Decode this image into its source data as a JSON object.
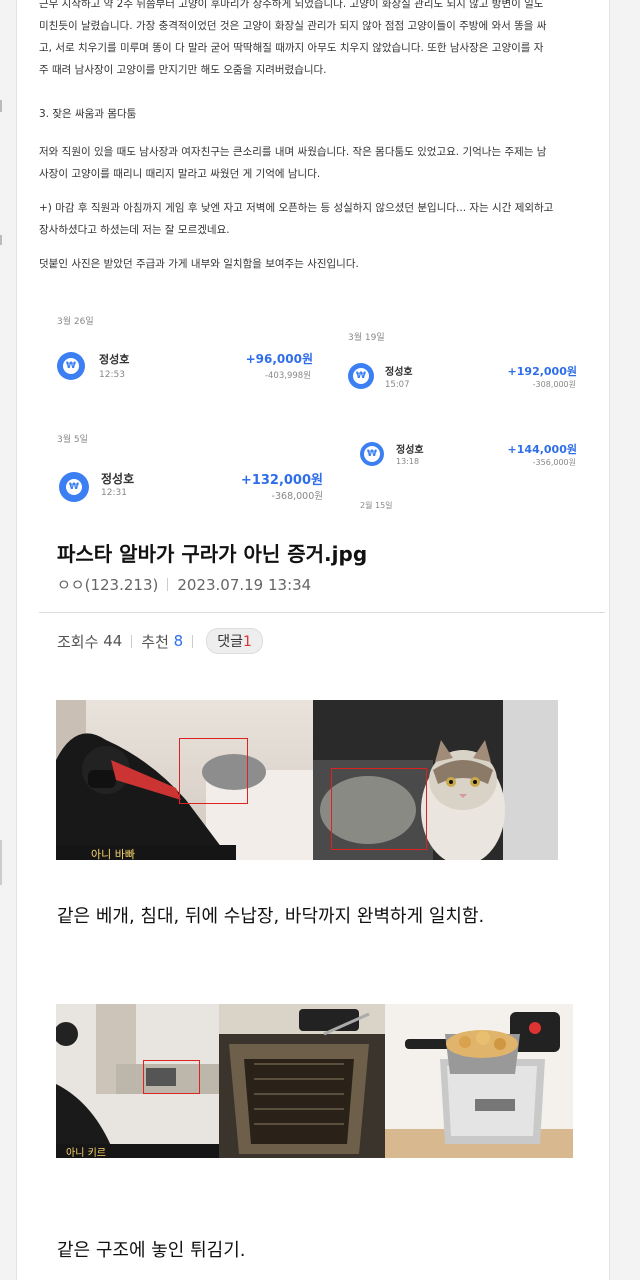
{
  "screenshot": {
    "para1_line1": "근무 시작하고 약 2주 뒤쯤부터 고양이 후마리가 상주하게 되었습니다. 고양이 화장실 관리도 되지 않고 방변이 일도",
    "para1_line2": "미친듯이 날렸습니다. 가장 충격적이었던 것은 고양이 화장실 관리가 되지 않아 점점 고양이들이 주방에 와서 똥을 싸",
    "para1_line3": "고, 서로 치우기를 미루며 똥이 다 말라 굳어 딱딱해질 때까지 아무도 치우지 않았습니다. 또한 남사장은 고양이를 자",
    "para1_line4": "주 때려 남사장이 고양이를 만지기만 해도 오줌을 지려버렸습니다.",
    "heading3": "3. 잦은 싸움과 몸다툼",
    "para2_line1": "저와 직원이 있을 때도 남사장과 여자친구는 큰소리를 내며 싸웠습니다. 작은 몸다툼도 있었고요. 기억나는 주제는 남",
    "para2_line2": "사장이 고양이를 때리니 때리지 말라고 싸웠던 게 기억에 남니다.",
    "para3_line1": "+) 마감 후 직원과 아침까지 게임 후 낮엔 자고 저벽에 오픈하는 등 성실하지 않으셨던 분입니다... 자는 시간 제외하고",
    "para3_line2": "장사하셨다고 하셨는데 저는 잘 모르겠네요.",
    "para4": "덧붙인 사진은 받았던 주급과 가게 내부와 일치함을 보여주는 사진입니다.",
    "transactions": [
      {
        "date": "3월 26일",
        "name": "정성호",
        "time": "12:53",
        "amount": "+96,000원",
        "balance": "-403,998원"
      },
      {
        "date": "3월 19일",
        "name": "정성호",
        "time": "15:07",
        "amount": "+192,000원",
        "balance": "-308,000원"
      },
      {
        "date": "3월 5일",
        "name": "정성호",
        "time": "12:31",
        "amount": "+132,000원",
        "balance": "-368,000원"
      },
      {
        "date": "2월 15일",
        "name": "정성호",
        "time": "13:18",
        "amount": "+144,000원",
        "balance": "-356,000원"
      }
    ],
    "coin_symbol": "₩"
  },
  "post": {
    "title": "파스타 알바가 구라가 아닌 증거.jpg",
    "author": "ㅇㅇ(123.213)",
    "datetime": "2023.07.19 13:34",
    "views_label": "조회수",
    "views": "44",
    "recommend_label": "추천",
    "recommend": "8",
    "comment_label": "댓글",
    "comment_count": "1"
  },
  "captions": {
    "caption1": "같은 베개, 침대, 뒤에 수납장, 바닥까지 완벽하게 일치함.",
    "caption2": "같은 구조에 놓인 튀김기."
  },
  "photo_overlay_text": {
    "photo1_subtitle": "아니 바빠",
    "photo3_subtitle": "아니 키르"
  },
  "colors": {
    "accent_blue": "#2f6ee8",
    "coin_blue": "#3b7ff3",
    "comment_red": "#d33333",
    "highlight_red": "#d22222"
  }
}
